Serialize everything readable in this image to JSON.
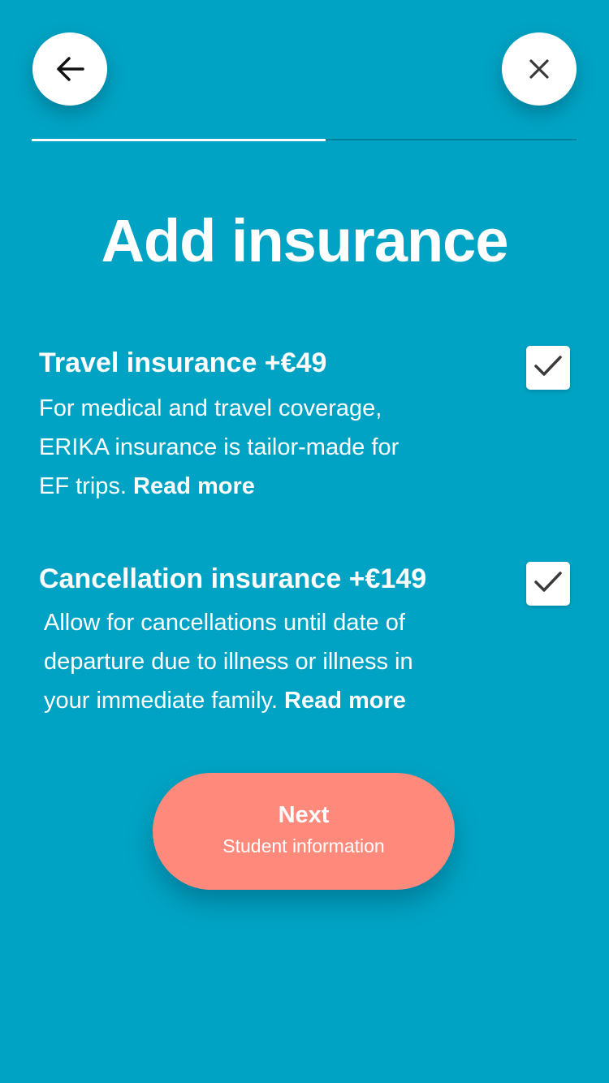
{
  "header": {
    "back_icon": "arrow-left-icon",
    "close_icon": "close-icon",
    "progress_fraction": 0.54
  },
  "title": "Add insurance",
  "options": [
    {
      "title": "Travel insurance +€49",
      "description_lines": [
        "For medical and travel coverage,",
        "ERIKA insurance is tailor-made for",
        "EF trips."
      ],
      "read_more": "Read more",
      "checked": true,
      "checkbox_icon": "checkmark-icon"
    },
    {
      "title": "Cancellation insurance +€149",
      "description_lines": [
        "Allow for cancellations until date of",
        "departure due to illness or illness in",
        "your immediate family."
      ],
      "read_more": "Read more",
      "checked": true,
      "checkbox_icon": "checkmark-icon"
    }
  ],
  "next_button": {
    "label": "Next",
    "sublabel": "Student information"
  },
  "colors": {
    "background": "#00A3C4",
    "accent": "#FF8A7C",
    "text": "#FFFFFF",
    "icon": "#3A3A3A"
  }
}
